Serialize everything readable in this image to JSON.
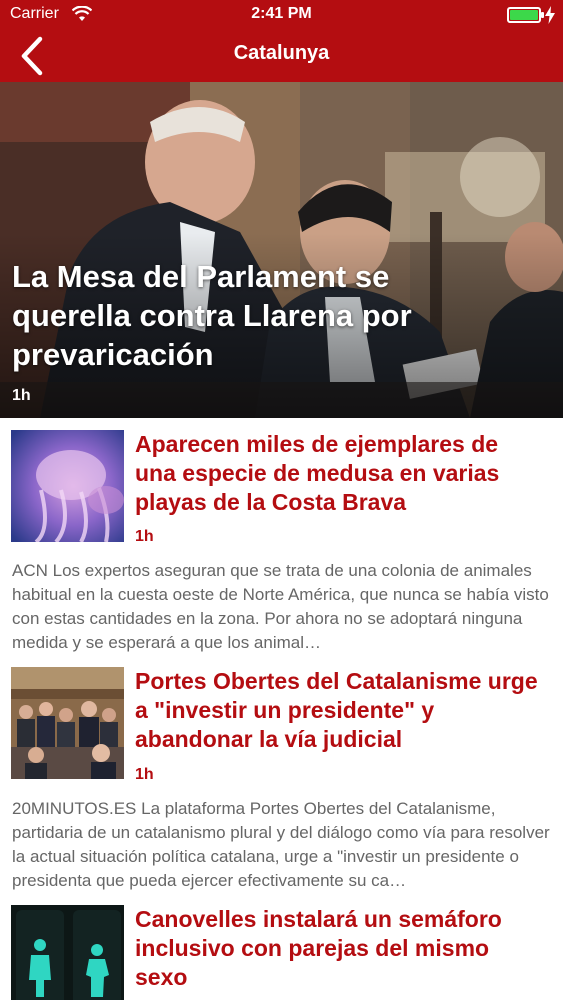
{
  "status_bar": {
    "carrier": "Carrier",
    "time": "2:41 PM"
  },
  "nav": {
    "title": "Catalunya"
  },
  "hero": {
    "headline": "La Mesa del Parlament se querella contra Llarena por prevaricación",
    "age": "1h"
  },
  "articles": [
    {
      "title": "Aparecen miles de ejemplares de una especie de medusa en varias playas de la Costa Brava",
      "age": "1h",
      "summary": "ACN Los expertos aseguran que se trata de una colonia de animales habitual en la cuesta oeste de Norte América, que nunca se había visto con estas cantidades en la zona. Por ahora no se adoptará ninguna medida y se esperará a que los animal…"
    },
    {
      "title": "Portes Obertes del Catalanisme urge a \"investir un presidente\" y abandonar la vía judicial",
      "age": "1h",
      "summary": "20MINUTOS.ES La plataforma Portes Obertes del Catalanisme, partidaria de un catalanismo plural y del diálogo como vía para resolver la actual situación política catalana, urge a \"investir un presidente o presidenta que pueda ejercer efectivamente su ca…"
    },
    {
      "title": "Canovelles instalará un semáforo inclusivo con parejas del mismo sexo"
    }
  ],
  "colors": {
    "brand_red": "#b40d11",
    "summary_gray": "#666666"
  },
  "icons": [
    "wifi-icon",
    "battery-icon",
    "charging-icon",
    "back-chevron-icon"
  ]
}
